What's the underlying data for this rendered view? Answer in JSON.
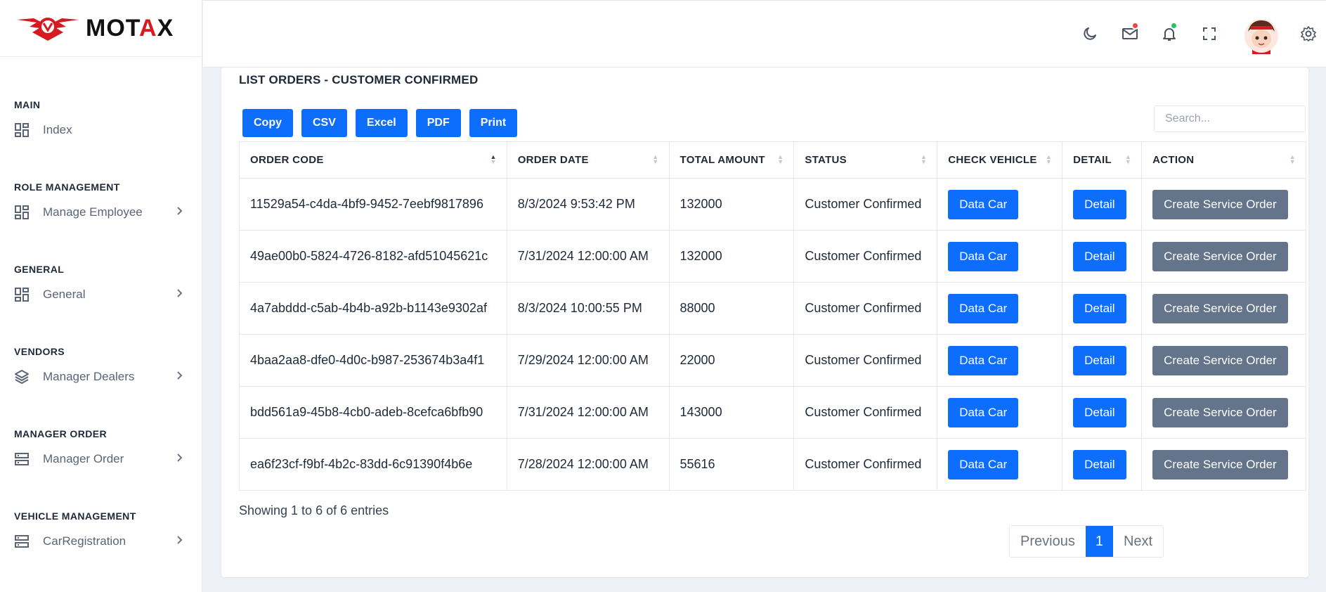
{
  "brand": {
    "name_left": "MOT",
    "name_accent": "A",
    "name_right": "X"
  },
  "colors": {
    "primary": "#0d6efd",
    "action_gray": "#64748b",
    "brand_red": "#d71920",
    "mail_badge": "#ef4444",
    "bell_badge": "#22c55e"
  },
  "sidebar": {
    "sections": [
      {
        "title": "MAIN",
        "item": {
          "label": "Index",
          "icon": "dashboard-icon",
          "has_chevron": false
        }
      },
      {
        "title": "ROLE MANAGEMENT",
        "item": {
          "label": "Manage Employee",
          "icon": "dashboard-icon",
          "has_chevron": true
        }
      },
      {
        "title": "GENERAL",
        "item": {
          "label": "General",
          "icon": "dashboard-icon",
          "has_chevron": true
        }
      },
      {
        "title": "VENDORS",
        "item": {
          "label": "Manager Dealers",
          "icon": "layers-icon",
          "has_chevron": true
        }
      },
      {
        "title": "MANAGER ORDER",
        "item": {
          "label": "Manager Order",
          "icon": "server-icon",
          "has_chevron": true
        }
      },
      {
        "title": "VEHICLE MANAGEMENT",
        "item": {
          "label": "CarRegistration",
          "icon": "server-icon",
          "has_chevron": true
        }
      }
    ]
  },
  "header": {
    "icons": [
      "moon-icon",
      "mail-icon",
      "bell-icon",
      "fullscreen-icon",
      "avatar",
      "gear-icon"
    ]
  },
  "card": {
    "title": "LIST ORDERS - CUSTOMER CONFIRMED",
    "export_buttons": [
      "Copy",
      "CSV",
      "Excel",
      "PDF",
      "Print"
    ],
    "search_placeholder": "Search..."
  },
  "table": {
    "columns": [
      "ORDER CODE",
      "ORDER DATE",
      "TOTAL AMOUNT",
      "STATUS",
      "CHECK VEHICLE",
      "DETAIL",
      "ACTION"
    ],
    "sorted_column": "ORDER CODE",
    "rows": [
      {
        "code": "11529a54-c4da-4bf9-9452-7eebf9817896",
        "date": "8/3/2024 9:53:42 PM",
        "amount": "132000",
        "status": "Customer Confirmed"
      },
      {
        "code": "49ae00b0-5824-4726-8182-afd51045621c",
        "date": "7/31/2024 12:00:00 AM",
        "amount": "132000",
        "status": "Customer Confirmed"
      },
      {
        "code": "4a7abddd-c5ab-4b4b-a92b-b1143e9302af",
        "date": "8/3/2024 10:00:55 PM",
        "amount": "88000",
        "status": "Customer Confirmed"
      },
      {
        "code": "4baa2aa8-dfe0-4d0c-b987-253674b3a4f1",
        "date": "7/29/2024 12:00:00 AM",
        "amount": "22000",
        "status": "Customer Confirmed"
      },
      {
        "code": "bdd561a9-45b8-4cb0-adeb-8cefca6bfb90",
        "date": "7/31/2024 12:00:00 AM",
        "amount": "143000",
        "status": "Customer Confirmed"
      },
      {
        "code": "ea6f23cf-f9bf-4b2c-83dd-6c91390f4b6e",
        "date": "7/28/2024 12:00:00 AM",
        "amount": "55616",
        "status": "Customer Confirmed"
      }
    ],
    "row_buttons": {
      "check_vehicle": "Data Car",
      "detail": "Detail",
      "action": "Create Service Order"
    }
  },
  "footer": {
    "info": "Showing 1 to 6 of 6 entries",
    "pagination": {
      "previous": "Previous",
      "current": "1",
      "next": "Next"
    }
  }
}
